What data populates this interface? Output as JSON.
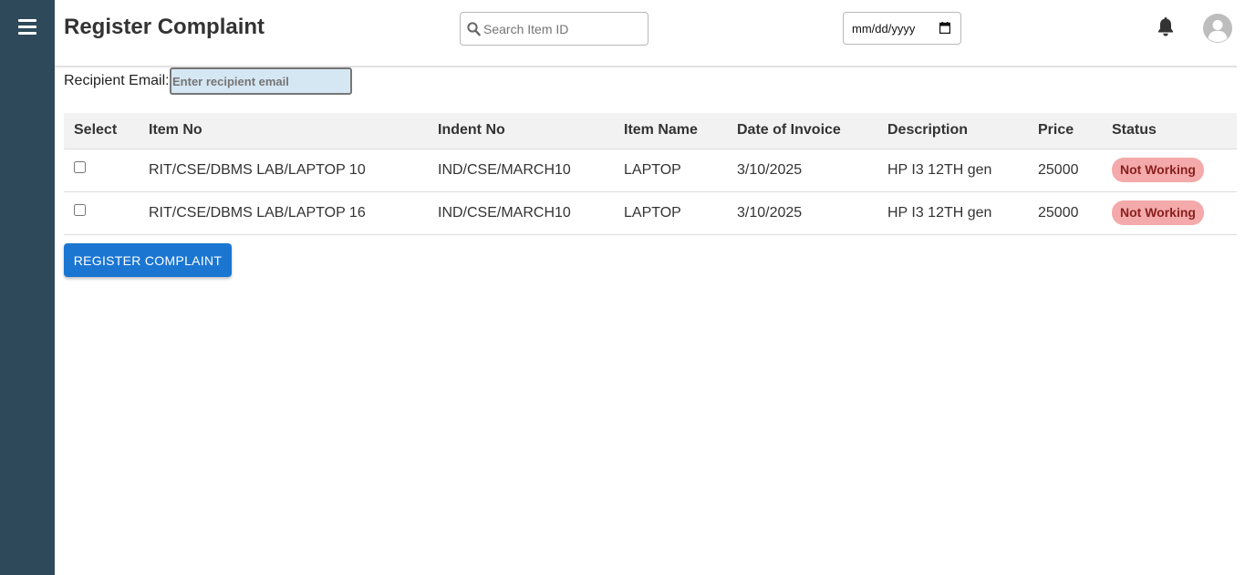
{
  "header": {
    "title": "Register Complaint",
    "search_placeholder": "Search Item ID",
    "date_placeholder": "mm/dd/yyyy"
  },
  "recipient": {
    "label": "Recipient Email:",
    "placeholder": "Enter recipient email"
  },
  "table": {
    "columns": [
      "Select",
      "Item No",
      "Indent No",
      "Item Name",
      "Date of Invoice",
      "Description",
      "Price",
      "Status"
    ],
    "rows": [
      {
        "checked": false,
        "item_no": "RIT/CSE/DBMS LAB/LAPTOP 10",
        "indent_no": "IND/CSE/MARCH10",
        "item_name": "LAPTOP",
        "date_of_invoice": "3/10/2025",
        "description": "HP I3 12TH gen",
        "price": "25000",
        "status": "Not Working"
      },
      {
        "checked": false,
        "item_no": "RIT/CSE/DBMS LAB/LAPTOP 16",
        "indent_no": "IND/CSE/MARCH10",
        "item_name": "LAPTOP",
        "date_of_invoice": "3/10/2025",
        "description": "HP I3 12TH gen",
        "price": "25000",
        "status": "Not Working"
      }
    ]
  },
  "actions": {
    "submit_label": "REGISTER COMPLAINT"
  },
  "icons": {
    "menu": "hamburger-menu-icon",
    "search": "search-icon",
    "calendar": "calendar-icon",
    "notifications": "bell-icon",
    "profile": "user-avatar-icon"
  },
  "colors": {
    "sidebar": "#2e4a5a",
    "primary_button": "#1b76d2",
    "status_badge_bg": "#f4aaaa",
    "status_badge_text": "#8a1f1f",
    "recipient_input_bg": "#d6e7f4"
  }
}
